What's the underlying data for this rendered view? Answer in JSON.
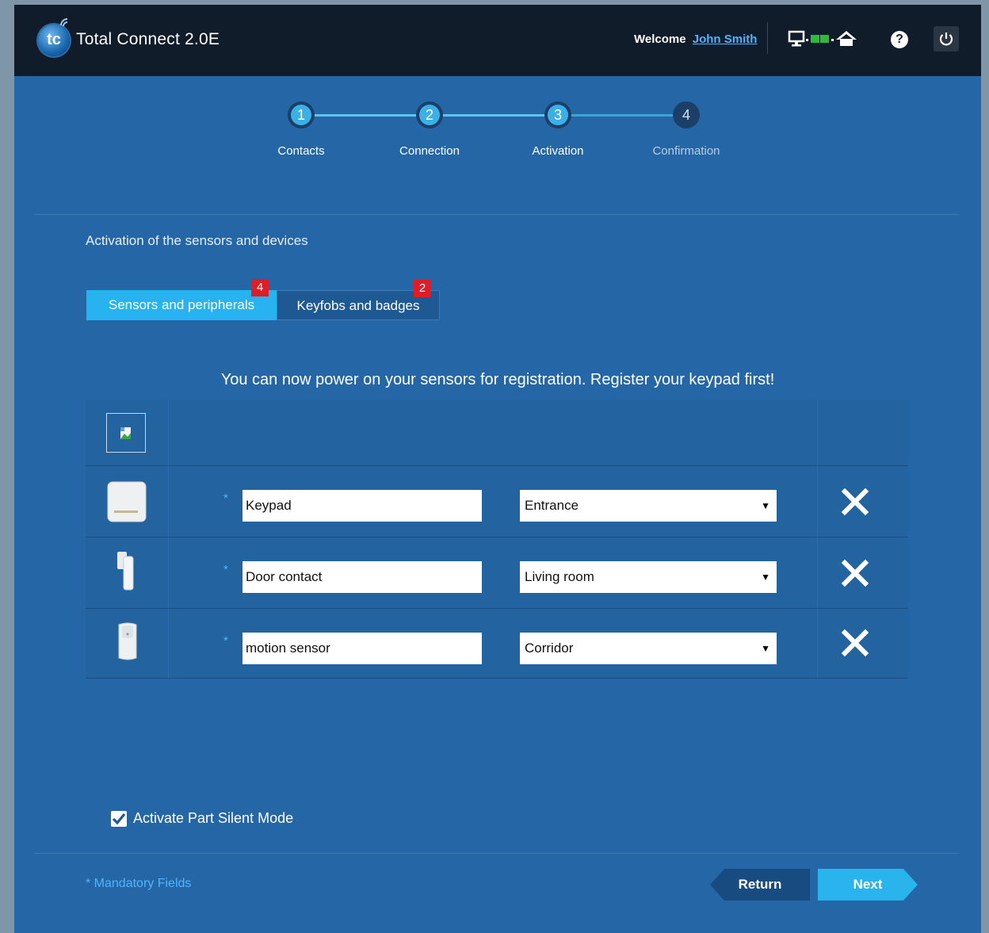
{
  "header": {
    "app_title": "Total Connect 2.0E",
    "logo_text": "tc",
    "welcome_prefix": "Welcome",
    "user_name": "John Smith",
    "help_label": "?"
  },
  "stepper": {
    "steps": [
      {
        "number": "1",
        "label": "Contacts",
        "state": "done"
      },
      {
        "number": "2",
        "label": "Connection",
        "state": "done"
      },
      {
        "number": "3",
        "label": "Activation",
        "state": "current"
      },
      {
        "number": "4",
        "label": "Confirmation",
        "state": "pending"
      }
    ]
  },
  "section_title": "Activation of the sensors and devices",
  "tabs": [
    {
      "label": "Sensors and peripherals",
      "badge": "4",
      "active": true
    },
    {
      "label": "Keyfobs and badges",
      "badge": "2",
      "active": false
    }
  ],
  "instruction": "You can now power on your sensors for registration. Register your keypad first!",
  "devices": [
    {
      "name": "Keypad",
      "location": "Entrance",
      "icon": "keypad-icon"
    },
    {
      "name": "Door contact",
      "location": "Living room",
      "icon": "door-contact-icon"
    },
    {
      "name": "motion sensor",
      "location": "Corridor",
      "icon": "motion-sensor-icon"
    }
  ],
  "required_marker": "*",
  "silent_mode": {
    "label": "Activate Part Silent Mode",
    "checked": true
  },
  "footer": {
    "mandatory_note": "* Mandatory Fields",
    "return_label": "Return",
    "next_label": "Next"
  },
  "colors": {
    "background": "#2566a6",
    "header": "#101c2a",
    "accent": "#27b3ef",
    "badge": "#e01d24",
    "link": "#4fb4ff"
  }
}
